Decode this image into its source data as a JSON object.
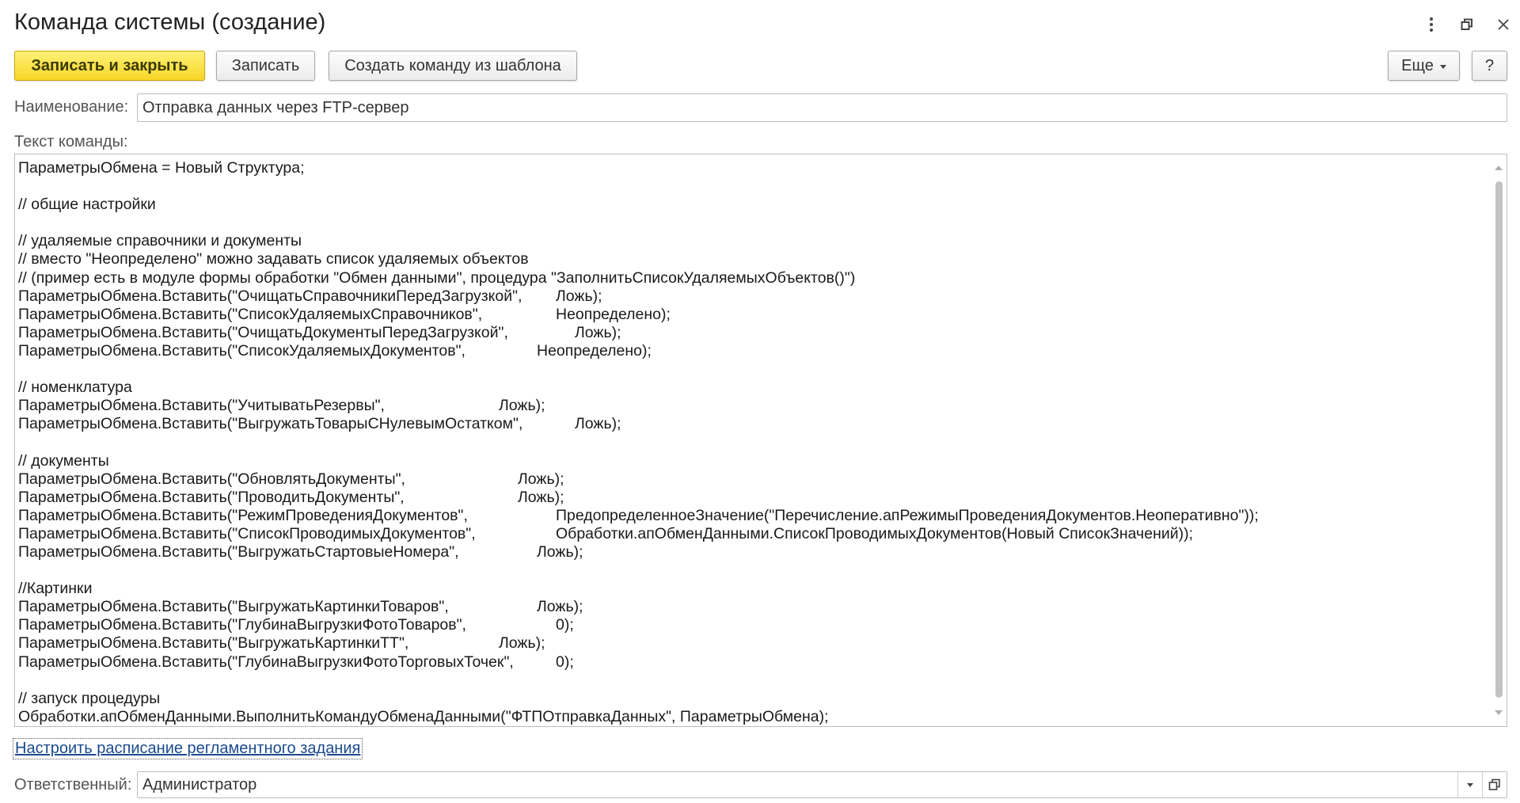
{
  "window": {
    "title": "Команда системы (создание)",
    "menu_icon": "more-vertical-icon",
    "restore_icon": "restore-window-icon",
    "close_icon": "close-icon"
  },
  "toolbar": {
    "save_close_label": "Записать и закрыть",
    "save_label": "Записать",
    "template_label": "Создать команду из шаблона",
    "more_label": "Еще",
    "help_label": "?"
  },
  "name_field": {
    "label": "Наименование:",
    "value": "Отправка данных через FTP-сервер"
  },
  "command_text": {
    "label": "Текст команды:",
    "lines": [
      {
        "a": "ПараметрыОбмена = Новый Структура;"
      },
      {
        "a": ""
      },
      {
        "a": "// общие настройки"
      },
      {
        "a": ""
      },
      {
        "a": "// удаляемые справочники и документы"
      },
      {
        "a": "// вместо \"Неопределено\" можно задавать список удаляемых объектов"
      },
      {
        "a": "// (пример есть в модуле формы обработки \"Обмен данными\", процедура \"ЗаполнитьСписокУдаляемыхОбъектов()\")"
      },
      {
        "a": "ПараметрыОбмена.Вставить(\"ОчищатьСправочникиПередЗагрузкой\",",
        "b": "Ложь);",
        "col": 3
      },
      {
        "a": "ПараметрыОбмена.Вставить(\"СписокУдаляемыхСправочников\",",
        "b": "Неопределено);",
        "col": 3
      },
      {
        "a": "ПараметрыОбмена.Вставить(\"ОчищатьДокументыПередЗагрузкой\",",
        "b": "Ложь);",
        "col": 4
      },
      {
        "a": "ПараметрыОбмена.Вставить(\"СписокУдаляемыхДокументов\",",
        "b": "Неопределено);",
        "col": 2
      },
      {
        "a": ""
      },
      {
        "a": "// номенклатура"
      },
      {
        "a": "ПараметрыОбмена.Вставить(\"УчитыватьРезервы\",",
        "b": "Ложь);",
        "col": 0
      },
      {
        "a": "ПараметрыОбмена.Вставить(\"ВыгружатьТоварыСНулевымОстатком\",",
        "b": "Ложь);",
        "col": 4
      },
      {
        "a": ""
      },
      {
        "a": "// документы"
      },
      {
        "a": "ПараметрыОбмена.Вставить(\"ОбновлятьДокументы\",",
        "b": "Ложь);",
        "col": 1
      },
      {
        "a": "ПараметрыОбмена.Вставить(\"ПроводитьДокументы\",",
        "b": "Ложь);",
        "col": 1
      },
      {
        "a": "ПараметрыОбмена.Вставить(\"РежимПроведенияДокументов\",",
        "b": "ПредопределенноеЗначение(\"Перечисление.апРежимыПроведенияДокументов.Неоперативно\"));",
        "col": 3
      },
      {
        "a": "ПараметрыОбмена.Вставить(\"СписокПроводимыхДокументов\",",
        "b": "Обработки.апОбменДанными.СписокПроводимыхДокументов(Новый СписокЗначений));",
        "col": 3
      },
      {
        "a": "ПараметрыОбмена.Вставить(\"ВыгружатьСтартовыеНомера\",",
        "b": "Ложь);",
        "col": 2
      },
      {
        "a": ""
      },
      {
        "a": "//Картинки"
      },
      {
        "a": "ПараметрыОбмена.Вставить(\"ВыгружатьКартинкиТоваров\",",
        "b": "Ложь);",
        "col": 2
      },
      {
        "a": "ПараметрыОбмена.Вставить(\"ГлубинаВыгрузкиФотоТоваров\",",
        "b": "0);",
        "col": 3
      },
      {
        "a": "ПараметрыОбмена.Вставить(\"ВыгружатьКартинкиТТ\",",
        "b": "Ложь);",
        "col": 0
      },
      {
        "a": "ПараметрыОбмена.Вставить(\"ГлубинаВыгрузкиФотоТорговыхТочек\",",
        "b": "0);",
        "col": 3
      },
      {
        "a": ""
      },
      {
        "a": "// запуск процедуры"
      },
      {
        "a": "Обработки.апОбменДанными.ВыполнитьКомандуОбменаДанными(\"ФТПОтправкаДанных\", ПараметрыОбмена);"
      }
    ]
  },
  "schedule_link": "Настроить расписание регламентного задания",
  "responsible": {
    "label": "Ответственный:",
    "value": "Администратор"
  }
}
